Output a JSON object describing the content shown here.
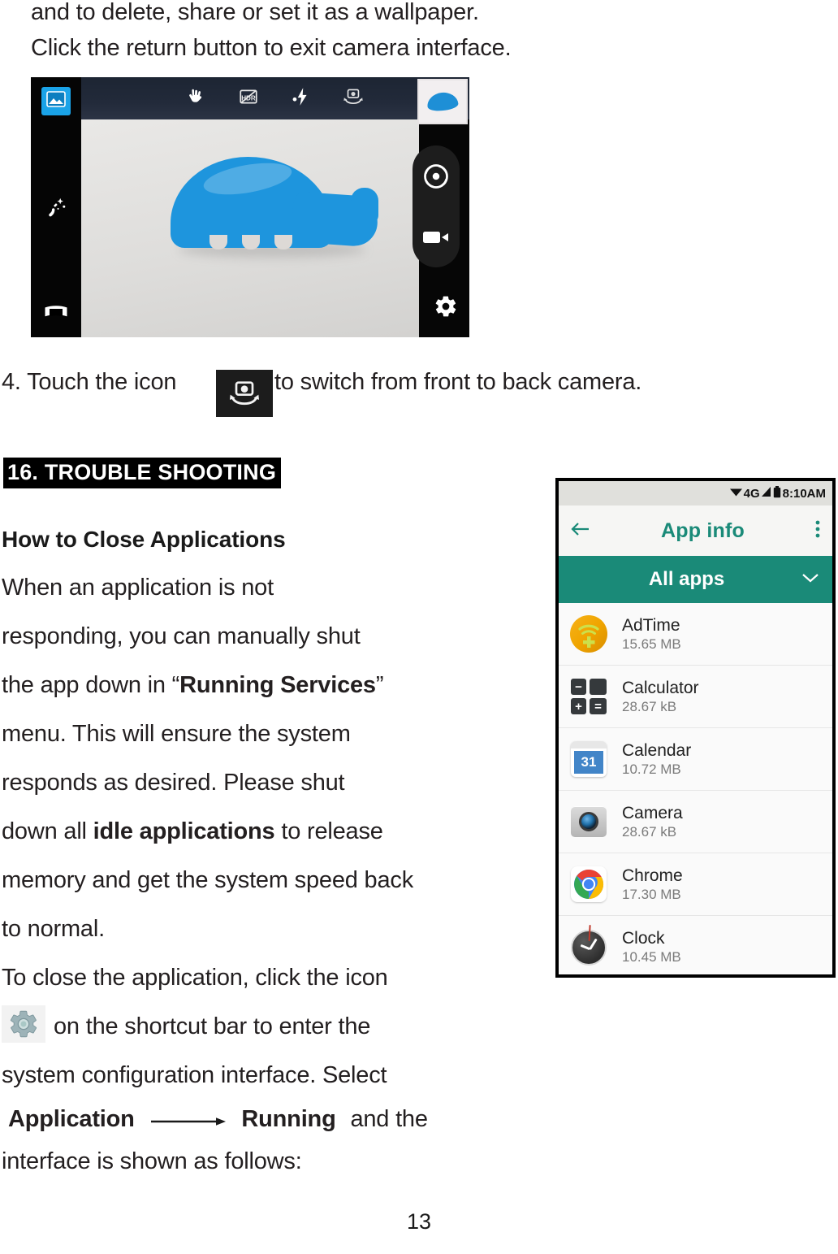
{
  "document": {
    "page_number": "13",
    "intro_lines": [
      "and to delete, share or set it as a wallpaper.",
      "Click the return button to exit camera interface."
    ],
    "step4": {
      "prefix": "4. Touch the icon",
      "icon": "camera-switch-icon",
      "suffix": "to switch from front to back  camera."
    },
    "section_heading": "16. TROUBLE SHOOTING",
    "sub_heading": "How to Close Applications",
    "body_lines": [
      {
        "id": "l1",
        "parts": [
          {
            "t": "When an application is not",
            "b": false
          }
        ]
      },
      {
        "id": "l2",
        "parts": [
          {
            "t": "responding, you can manually shut",
            "b": false
          }
        ]
      },
      {
        "id": "l3",
        "parts": [
          {
            "t": "the app down in “",
            "b": false
          },
          {
            "t": "Running Services",
            "b": true
          },
          {
            "t": "”",
            "b": false
          }
        ]
      },
      {
        "id": "l4",
        "parts": [
          {
            "t": "menu. This will ensure the system",
            "b": false
          }
        ]
      },
      {
        "id": "l5",
        "parts": [
          {
            "t": "responds as desired. Please shut",
            "b": false
          }
        ]
      },
      {
        "id": "l6",
        "parts": [
          {
            "t": "down all ",
            "b": false
          },
          {
            "t": "idle applications",
            "b": true
          },
          {
            "t": " to release",
            "b": false
          }
        ]
      },
      {
        "id": "l7",
        "parts": [
          {
            "t": "memory and get the system speed back",
            "b": false
          }
        ]
      },
      {
        "id": "l8",
        "parts": [
          {
            "t": "to  normal.",
            "b": false
          }
        ]
      },
      {
        "id": "l9",
        "parts": [
          {
            "t": "To close the application, click the icon",
            "b": false
          }
        ]
      }
    ],
    "gear_line_suffix": "on the shortcut bar to enter the",
    "line_select": "system configuration interface. Select",
    "nav_line": {
      "from": "Application",
      "to": "Running",
      "tail": "and the"
    },
    "closing_line": "interface is shown as follows:"
  },
  "camera_ui": {
    "left_rail": [
      {
        "name": "photo-mode-icon",
        "label": "Photo mode",
        "active": true
      },
      {
        "name": "effects-wand-icon",
        "label": "Effects"
      },
      {
        "name": "panorama-icon",
        "label": "Panorama"
      }
    ],
    "top_bar": [
      {
        "name": "gesture-shot-icon",
        "label": "Gesture shot"
      },
      {
        "name": "hdr-icon",
        "label": "HDR off"
      },
      {
        "name": "flash-icon",
        "label": "Flash auto"
      },
      {
        "name": "camera-switch-icon",
        "label": "Switch camera"
      }
    ],
    "thumbnail": {
      "name": "last-photo-thumbnail",
      "label": "Last photo"
    },
    "right_controls": [
      {
        "name": "shutter-button",
        "label": "Shutter"
      },
      {
        "name": "video-record-button",
        "label": "Record video"
      }
    ],
    "settings": {
      "name": "camera-settings-icon",
      "label": "Settings"
    },
    "subject": {
      "name": "elephant-figurine",
      "label": "Blue elephant figurine",
      "color": "#1e95dd"
    }
  },
  "phone": {
    "status_bar": {
      "wifi": "wifi-icon",
      "network": "4G",
      "signal": "signal-icon",
      "battery": "battery-icon",
      "time": "8:10AM"
    },
    "app_bar": {
      "back": "back-arrow-icon",
      "title": "App info",
      "overflow": "overflow-menu-icon"
    },
    "filter": {
      "label": "All apps",
      "chevron": "chevron-down-icon"
    },
    "apps": [
      {
        "name": "AdTime",
        "size": "15.65 MB",
        "icon": "adtime-icon"
      },
      {
        "name": "Calculator",
        "size": "28.67 kB",
        "icon": "calculator-icon"
      },
      {
        "name": "Calendar",
        "size": "10.72 MB",
        "icon": "calendar-icon",
        "day": "31"
      },
      {
        "name": "Camera",
        "size": "28.67 kB",
        "icon": "camera-icon"
      },
      {
        "name": "Chrome",
        "size": "17.30 MB",
        "icon": "chrome-icon"
      },
      {
        "name": "Clock",
        "size": "10.45 MB",
        "icon": "clock-icon"
      }
    ]
  },
  "colors": {
    "teal": "#1a8a78",
    "accent_blue": "#1e95dd",
    "status_bar": "#e0e0dc"
  }
}
